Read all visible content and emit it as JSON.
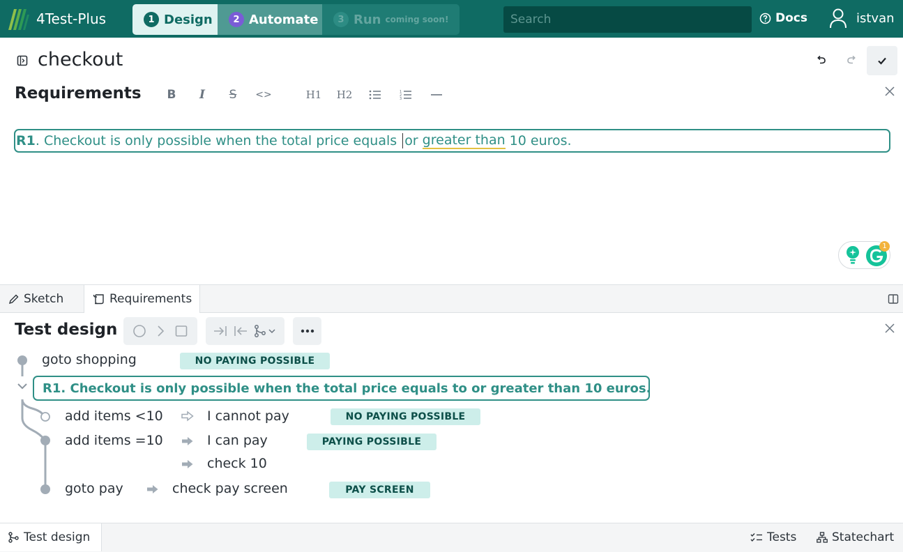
{
  "app": {
    "name": "4Test-Plus",
    "steps": [
      {
        "num": "1",
        "label": "Design"
      },
      {
        "num": "2",
        "label": "Automate"
      },
      {
        "num": "3",
        "label": "Run",
        "note": "coming soon!"
      }
    ],
    "search_placeholder": "Search",
    "docs_label": "Docs",
    "user_name": "istvan"
  },
  "document": {
    "title": "checkout"
  },
  "requirements": {
    "title": "Requirements",
    "toolbar": [
      "B",
      "I",
      "S",
      "<>",
      "H1",
      "H2",
      "bullet-list",
      "ordered-list",
      "horizontal-rule"
    ],
    "line": {
      "id": "R1",
      "text_a": ". Checkout is only possible when the total price equals ",
      "text_b": "or ",
      "text_c": "greater than",
      "text_d": " 10 euros."
    },
    "grammarly_count": "1"
  },
  "tabs": {
    "sketch": "Sketch",
    "requirements": "Requirements"
  },
  "test_design": {
    "title": "Test design",
    "nodes": {
      "n1": {
        "label": "goto shopping",
        "badge": "NO PAYING POSSIBLE"
      },
      "req": {
        "label": "R1. Checkout is only possible when the total price equals to or greater than 10 euros."
      },
      "n2": {
        "label": "add items <10",
        "action": "I cannot pay",
        "badge": "NO PAYING POSSIBLE"
      },
      "n3": {
        "label": "add items =10",
        "action": "I can pay",
        "badge": "PAYING POSSIBLE",
        "action2": "check 10"
      },
      "n4": {
        "label": "goto pay",
        "action": "check pay screen",
        "badge": "PAY SCREEN"
      }
    }
  },
  "bottom_tabs": {
    "design": "Test design",
    "tests": "Tests",
    "statechart": "Statechart"
  },
  "colors": {
    "brand": "#0f6b63",
    "accent": "#2f8f86",
    "badge_bg": "#cdeeea",
    "automate": "#7a5cd6"
  }
}
